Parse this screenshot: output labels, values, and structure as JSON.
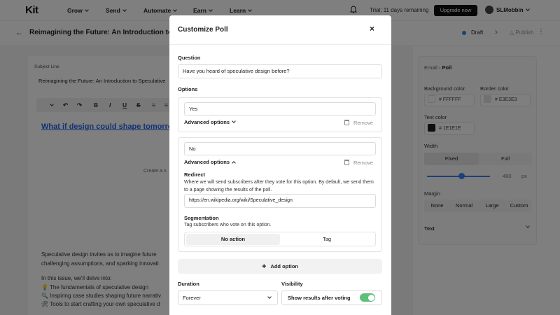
{
  "topnav": {
    "logo": "Kit",
    "items": [
      "Grow",
      "Send",
      "Automate",
      "Earn",
      "Learn"
    ],
    "trial": "Trial: 11 days remaining",
    "upgrade_label": "Upgrade now",
    "username": "SLMobbin"
  },
  "subbar": {
    "title": "Reimagining the Future: An Introduction to ...",
    "status": "Draft",
    "publish_label": "Publish"
  },
  "editor": {
    "subject_label": "Subject Line",
    "subject_value": "Reimagining the Future: An Introduction to Speculative",
    "toolbar": {
      "bold": "B",
      "italic": "I",
      "underline": "U"
    },
    "headline": "What if design could shape tomorrow",
    "create_hint": "Create a n",
    "paragraphs": [
      "Speculative design invites us to imagine future",
      "challenging assumptions, and sparking innovati",
      "In this issue, we'll delve into:",
      "💡 The fundamentals of speculative design",
      "🔍 Inspiring case studies shaping future narrativ",
      "🛠 Tools to start crafting your own speculative d"
    ]
  },
  "sidebar": {
    "breadcrumb_root": "Email",
    "breadcrumb_current": "Poll",
    "background_color_label": "Background color",
    "background_color_value": "FFFFFF",
    "border_color_label": "Border color",
    "border_color_value": "E3E3E3",
    "text_color_label": "Text color",
    "text_color_value": "1E1E1E",
    "width_label": "Width",
    "width_options": [
      "Fixed",
      "Full"
    ],
    "width_value": "480",
    "width_unit": "px",
    "margin_label": "Margin",
    "margin_options": [
      "None",
      "Normal",
      "Large",
      "Custom"
    ],
    "text_section": "Text"
  },
  "modal": {
    "title": "Customize Poll",
    "question_label": "Question",
    "question_value": "Have you heard of speculative design before?",
    "options_label": "Options",
    "options": [
      {
        "value": "Yes",
        "advanced_label": "Advanced options",
        "remove_label": "Remove"
      },
      {
        "value": "No",
        "advanced_label": "Advanced options",
        "remove_label": "Remove"
      }
    ],
    "redirect_label": "Redirect",
    "redirect_hint": "Where we will send subscribers after they vote for this option. By default, we send them to a page showing the results of the poll.",
    "redirect_url": "https://en.wikipedia.org/wiki/Speculative_design",
    "segmentation_label": "Segmentation",
    "segmentation_hint": "Tag subscribers who vote on this option.",
    "segmentation_options": [
      "No action",
      "Tag"
    ],
    "add_option_label": "Add option",
    "duration_label": "Duration",
    "duration_value": "Forever",
    "visibility_label": "Visibility",
    "visibility_toggle_label": "Show results after voting",
    "visibility_toggle_on": true
  },
  "colors": {
    "accent": "#3b82f6",
    "toggle_on": "#5cc07a",
    "text_color_swatch": "#1E1E1E",
    "border_color_swatch": "#E3E3E3",
    "background_color_swatch": "#FFFFFF"
  }
}
